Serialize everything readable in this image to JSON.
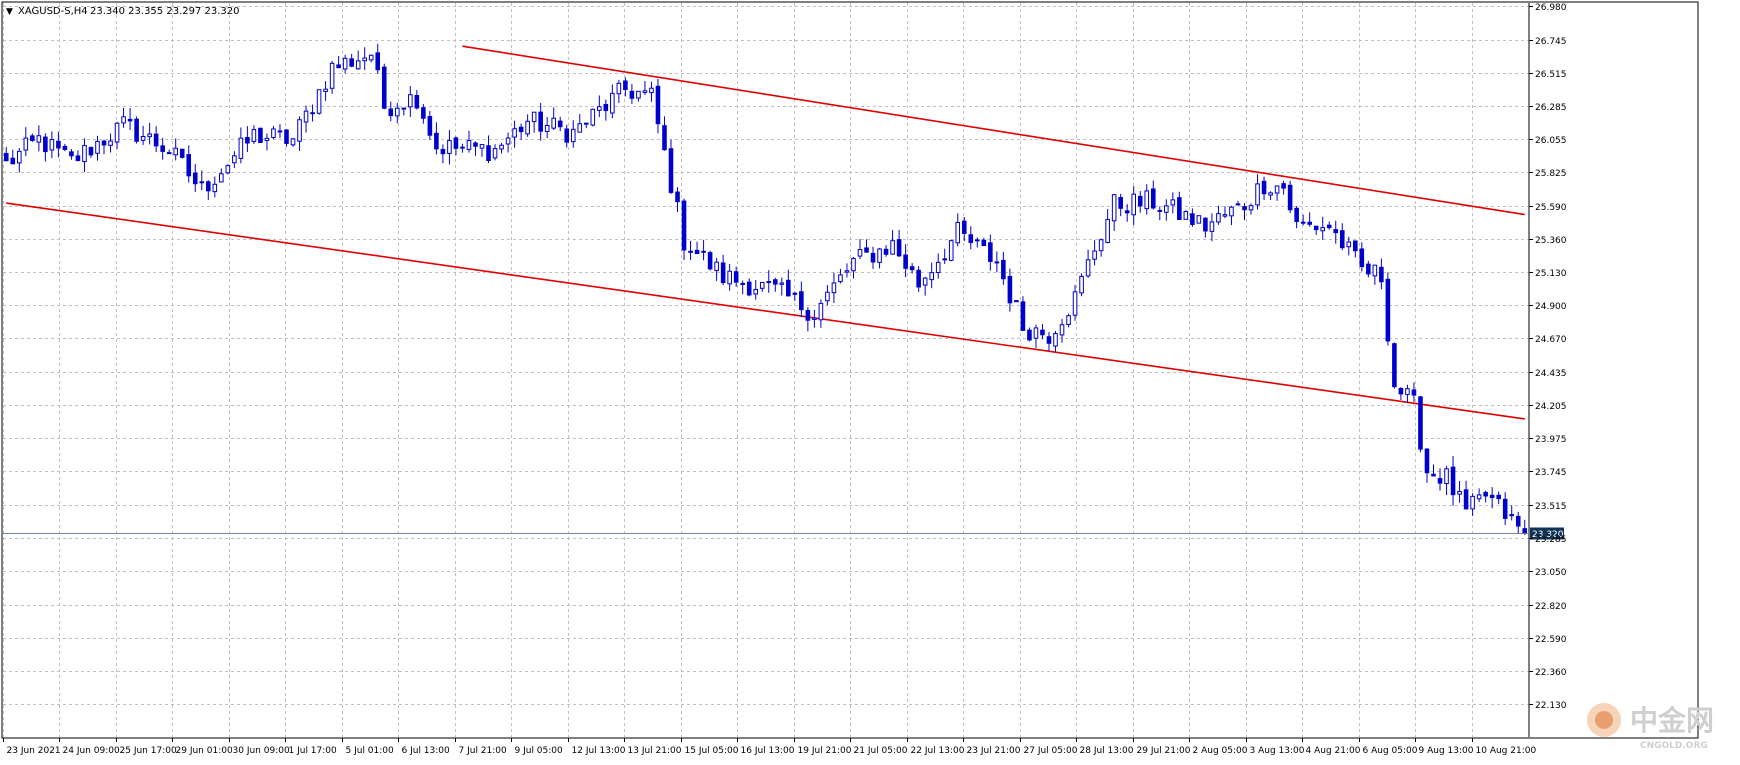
{
  "window": {
    "menu_glyph": "▼",
    "symbol_label": "XAGUSD-S,H4",
    "ohlc_label": "23.340 23.355 23.297 23.320"
  },
  "watermark": {
    "brand_text": "中金网",
    "site_text": "CNGOLD.ORG"
  },
  "colors": {
    "background": "#ffffff",
    "grid": "#c0c0c0",
    "candle": "#0000cc",
    "trendline": "#e00000",
    "bid_line": "#6e86a0",
    "price_tag_bg": "#123456",
    "price_tag_text": "#ffffff",
    "axis_text": "#000000"
  },
  "chart_data": {
    "type": "candlestick",
    "symbol": "XAGUSD-S",
    "timeframe": "H4",
    "current_price": 23.32,
    "current_price_label": "23.320",
    "ylim": [
      21.9,
      27.0
    ],
    "grid": true,
    "y_ticks": [
      "26.980",
      "26.745",
      "26.515",
      "26.285",
      "26.055",
      "25.825",
      "25.590",
      "25.360",
      "25.130",
      "24.900",
      "24.670",
      "24.435",
      "24.205",
      "23.975",
      "23.745",
      "23.515",
      "23.285",
      "23.050",
      "22.820",
      "22.590",
      "22.360",
      "22.130"
    ],
    "x_labels": [
      "23 Jun 2021",
      "24 Jun 09:00",
      "25 Jun 17:00",
      "29 Jun 01:00",
      "30 Jun 09:00",
      "1 Jul 17:00",
      "5 Jul 01:00",
      "6 Jul 13:00",
      "7 Jul 21:00",
      "9 Jul 05:00",
      "12 Jul 13:00",
      "13 Jul 21:00",
      "15 Jul 05:00",
      "16 Jul 13:00",
      "19 Jul 21:00",
      "21 Jul 05:00",
      "22 Jul 13:00",
      "23 Jul 21:00",
      "27 Jul 05:00",
      "28 Jul 13:00",
      "29 Jul 21:00",
      "2 Aug 05:00",
      "3 Aug 13:00",
      "4 Aug 21:00",
      "6 Aug 05:00",
      "9 Aug 13:00",
      "10 Aug 21:00"
    ],
    "keypoints": [
      [
        0,
        25.88
      ],
      [
        5,
        26.05
      ],
      [
        10,
        25.9
      ],
      [
        18,
        26.15
      ],
      [
        25,
        25.98
      ],
      [
        30,
        25.7
      ],
      [
        38,
        26.08
      ],
      [
        44,
        26.05
      ],
      [
        50,
        26.55
      ],
      [
        56,
        26.65
      ],
      [
        58,
        26.28
      ],
      [
        63,
        26.35
      ],
      [
        66,
        26.0
      ],
      [
        75,
        25.98
      ],
      [
        80,
        26.18
      ],
      [
        87,
        26.1
      ],
      [
        95,
        26.4
      ],
      [
        99,
        26.35
      ],
      [
        104,
        25.35
      ],
      [
        110,
        25.1
      ],
      [
        118,
        25.0
      ],
      [
        124,
        24.85
      ],
      [
        130,
        25.2
      ],
      [
        136,
        25.32
      ],
      [
        140,
        25.05
      ],
      [
        146,
        25.4
      ],
      [
        152,
        25.2
      ],
      [
        156,
        24.75
      ],
      [
        160,
        24.7
      ],
      [
        164,
        24.95
      ],
      [
        167,
        25.3
      ],
      [
        170,
        25.6
      ],
      [
        176,
        25.62
      ],
      [
        184,
        25.45
      ],
      [
        190,
        25.6
      ],
      [
        193,
        25.75
      ],
      [
        196,
        25.72
      ],
      [
        198,
        25.45
      ],
      [
        203,
        25.45
      ],
      [
        208,
        25.15
      ],
      [
        211,
        25.1
      ],
      [
        213,
        24.35
      ],
      [
        216,
        24.2
      ],
      [
        218,
        23.75
      ],
      [
        221,
        23.7
      ],
      [
        224,
        23.45
      ],
      [
        227,
        23.58
      ],
      [
        230,
        23.45
      ],
      [
        232,
        23.35
      ],
      [
        233,
        23.32
      ]
    ],
    "trendlines": [
      {
        "name": "upper channel",
        "start": [
          70,
          26.7
        ],
        "end": [
          233,
          25.53
        ]
      },
      {
        "name": "lower channel",
        "start": [
          0,
          25.61
        ],
        "end": [
          233,
          24.11
        ]
      }
    ]
  }
}
